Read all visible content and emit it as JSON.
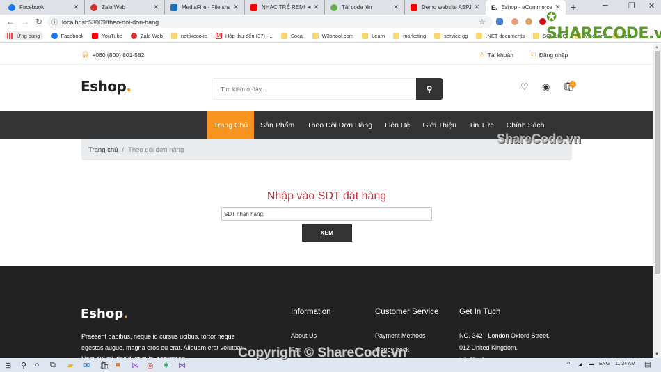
{
  "browser": {
    "tabs": [
      {
        "label": "Facebook",
        "icon": "facebook-icon",
        "color": "#1877f2"
      },
      {
        "label": "Zalo Web",
        "icon": "zalo-icon",
        "color": "#d32f2f"
      },
      {
        "label": "MediaFire - File sharing",
        "icon": "mediafire-icon",
        "color": "#1e73be"
      },
      {
        "label": "NHẠC TRẺ REMIX",
        "icon": "youtube-icon",
        "color": "#ff0000"
      },
      {
        "label": "Tải code lên",
        "icon": "sharecode-icon",
        "color": "#6ab04c"
      },
      {
        "label": "Demo website ASP.NE",
        "icon": "youtube-icon",
        "color": "#ff0000"
      },
      {
        "label": "Eshop - eCommerce H",
        "icon": "eshop-icon",
        "color": "#222222",
        "active": true
      }
    ],
    "url": "localhost:53069/theo-doi-don-hang",
    "bookmarks": [
      {
        "label": "Ứng dụng",
        "icon": "apps-icon"
      },
      {
        "label": "Facebook",
        "icon": "facebook-icon"
      },
      {
        "label": "YouTube",
        "icon": "youtube-icon"
      },
      {
        "label": "Zalo Web",
        "icon": "zalo-icon"
      },
      {
        "label": "netfixcooke",
        "icon": "folder-icon"
      },
      {
        "label": "Hộp thư đến (37) -...",
        "icon": "gmail-icon"
      },
      {
        "label": "Socal",
        "icon": "folder-icon"
      },
      {
        "label": "W3shool.com",
        "icon": "folder-icon"
      },
      {
        "label": "Learn",
        "icon": "folder-icon"
      },
      {
        "label": "marketing",
        "icon": "folder-icon"
      },
      {
        "label": "service gg",
        "icon": "folder-icon"
      },
      {
        "label": ".NET documents",
        "icon": "folder-icon"
      },
      {
        "label": "SQL LINQ",
        "icon": "folder-icon"
      },
      {
        "label": "ViecLam",
        "icon": "folder-icon"
      },
      {
        "label": "test",
        "icon": "folder-icon"
      }
    ]
  },
  "site": {
    "phone": "+060 (800) 801-582",
    "account_label": "Tài khoản",
    "login_label": "Đăng nhập",
    "logo": "Eshop",
    "logo_dot": ".",
    "search_placeholder": "Tìm kiếm ở đây....",
    "cart_count": "2",
    "menu": [
      "Trang Chủ",
      "Sản Phẩm",
      "Theo Dõi Đơn Hàng",
      "Liên Hệ",
      "Giới Thiệu",
      "Tin Tức",
      "Chính Sách"
    ],
    "breadcrumb": {
      "home": "Trang chủ",
      "separator": "/",
      "current": "Theo dõi đơn hàng"
    },
    "form": {
      "heading": "Nhập vào SDT đặt hàng",
      "input_value": "SDT nhận hàng.",
      "submit_label": "XEM"
    },
    "footer": {
      "logo": "Eshop",
      "logo_dot": ".",
      "description": "Praesent dapibus, neque id cursus ucibus, tortor neque egestas augue, magna eros eu erat. Aliquam erat volutpat. Nam dui mi, tincidunt quis, accumsan",
      "columns": [
        {
          "title": "Information",
          "links": [
            "About Us",
            "Faq"
          ]
        },
        {
          "title": "Customer Service",
          "links": [
            "Payment Methods",
            "Money-back"
          ]
        },
        {
          "title": "Get In Tuch",
          "links": [
            "NO. 342 - London Oxford Street.",
            "012 United Kingdom.",
            "info@eshop.com"
          ]
        }
      ]
    },
    "accent_color": "#f7941d"
  },
  "taskbar": {
    "language": "ENG",
    "time": "11:34 AM"
  },
  "watermarks": {
    "top": "SHARECODE.vn",
    "middle": "ShareCode.vn",
    "bottom": "Copyright © ShareCode.vn"
  }
}
